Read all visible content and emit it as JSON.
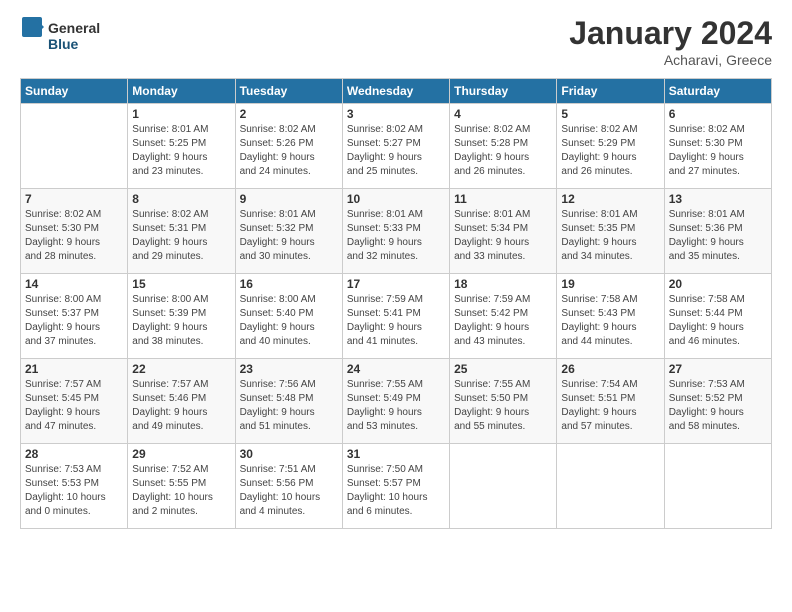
{
  "header": {
    "logo_general": "General",
    "logo_blue": "Blue",
    "title": "January 2024",
    "location": "Acharavi, Greece"
  },
  "days_of_week": [
    "Sunday",
    "Monday",
    "Tuesday",
    "Wednesday",
    "Thursday",
    "Friday",
    "Saturday"
  ],
  "weeks": [
    [
      {
        "day": "",
        "info": ""
      },
      {
        "day": "1",
        "info": "Sunrise: 8:01 AM\nSunset: 5:25 PM\nDaylight: 9 hours\nand 23 minutes."
      },
      {
        "day": "2",
        "info": "Sunrise: 8:02 AM\nSunset: 5:26 PM\nDaylight: 9 hours\nand 24 minutes."
      },
      {
        "day": "3",
        "info": "Sunrise: 8:02 AM\nSunset: 5:27 PM\nDaylight: 9 hours\nand 25 minutes."
      },
      {
        "day": "4",
        "info": "Sunrise: 8:02 AM\nSunset: 5:28 PM\nDaylight: 9 hours\nand 26 minutes."
      },
      {
        "day": "5",
        "info": "Sunrise: 8:02 AM\nSunset: 5:29 PM\nDaylight: 9 hours\nand 26 minutes."
      },
      {
        "day": "6",
        "info": "Sunrise: 8:02 AM\nSunset: 5:30 PM\nDaylight: 9 hours\nand 27 minutes."
      }
    ],
    [
      {
        "day": "7",
        "info": "Sunrise: 8:02 AM\nSunset: 5:30 PM\nDaylight: 9 hours\nand 28 minutes."
      },
      {
        "day": "8",
        "info": "Sunrise: 8:02 AM\nSunset: 5:31 PM\nDaylight: 9 hours\nand 29 minutes."
      },
      {
        "day": "9",
        "info": "Sunrise: 8:01 AM\nSunset: 5:32 PM\nDaylight: 9 hours\nand 30 minutes."
      },
      {
        "day": "10",
        "info": "Sunrise: 8:01 AM\nSunset: 5:33 PM\nDaylight: 9 hours\nand 32 minutes."
      },
      {
        "day": "11",
        "info": "Sunrise: 8:01 AM\nSunset: 5:34 PM\nDaylight: 9 hours\nand 33 minutes."
      },
      {
        "day": "12",
        "info": "Sunrise: 8:01 AM\nSunset: 5:35 PM\nDaylight: 9 hours\nand 34 minutes."
      },
      {
        "day": "13",
        "info": "Sunrise: 8:01 AM\nSunset: 5:36 PM\nDaylight: 9 hours\nand 35 minutes."
      }
    ],
    [
      {
        "day": "14",
        "info": "Sunrise: 8:00 AM\nSunset: 5:37 PM\nDaylight: 9 hours\nand 37 minutes."
      },
      {
        "day": "15",
        "info": "Sunrise: 8:00 AM\nSunset: 5:39 PM\nDaylight: 9 hours\nand 38 minutes."
      },
      {
        "day": "16",
        "info": "Sunrise: 8:00 AM\nSunset: 5:40 PM\nDaylight: 9 hours\nand 40 minutes."
      },
      {
        "day": "17",
        "info": "Sunrise: 7:59 AM\nSunset: 5:41 PM\nDaylight: 9 hours\nand 41 minutes."
      },
      {
        "day": "18",
        "info": "Sunrise: 7:59 AM\nSunset: 5:42 PM\nDaylight: 9 hours\nand 43 minutes."
      },
      {
        "day": "19",
        "info": "Sunrise: 7:58 AM\nSunset: 5:43 PM\nDaylight: 9 hours\nand 44 minutes."
      },
      {
        "day": "20",
        "info": "Sunrise: 7:58 AM\nSunset: 5:44 PM\nDaylight: 9 hours\nand 46 minutes."
      }
    ],
    [
      {
        "day": "21",
        "info": "Sunrise: 7:57 AM\nSunset: 5:45 PM\nDaylight: 9 hours\nand 47 minutes."
      },
      {
        "day": "22",
        "info": "Sunrise: 7:57 AM\nSunset: 5:46 PM\nDaylight: 9 hours\nand 49 minutes."
      },
      {
        "day": "23",
        "info": "Sunrise: 7:56 AM\nSunset: 5:48 PM\nDaylight: 9 hours\nand 51 minutes."
      },
      {
        "day": "24",
        "info": "Sunrise: 7:55 AM\nSunset: 5:49 PM\nDaylight: 9 hours\nand 53 minutes."
      },
      {
        "day": "25",
        "info": "Sunrise: 7:55 AM\nSunset: 5:50 PM\nDaylight: 9 hours\nand 55 minutes."
      },
      {
        "day": "26",
        "info": "Sunrise: 7:54 AM\nSunset: 5:51 PM\nDaylight: 9 hours\nand 57 minutes."
      },
      {
        "day": "27",
        "info": "Sunrise: 7:53 AM\nSunset: 5:52 PM\nDaylight: 9 hours\nand 58 minutes."
      }
    ],
    [
      {
        "day": "28",
        "info": "Sunrise: 7:53 AM\nSunset: 5:53 PM\nDaylight: 10 hours\nand 0 minutes."
      },
      {
        "day": "29",
        "info": "Sunrise: 7:52 AM\nSunset: 5:55 PM\nDaylight: 10 hours\nand 2 minutes."
      },
      {
        "day": "30",
        "info": "Sunrise: 7:51 AM\nSunset: 5:56 PM\nDaylight: 10 hours\nand 4 minutes."
      },
      {
        "day": "31",
        "info": "Sunrise: 7:50 AM\nSunset: 5:57 PM\nDaylight: 10 hours\nand 6 minutes."
      },
      {
        "day": "",
        "info": ""
      },
      {
        "day": "",
        "info": ""
      },
      {
        "day": "",
        "info": ""
      }
    ]
  ]
}
